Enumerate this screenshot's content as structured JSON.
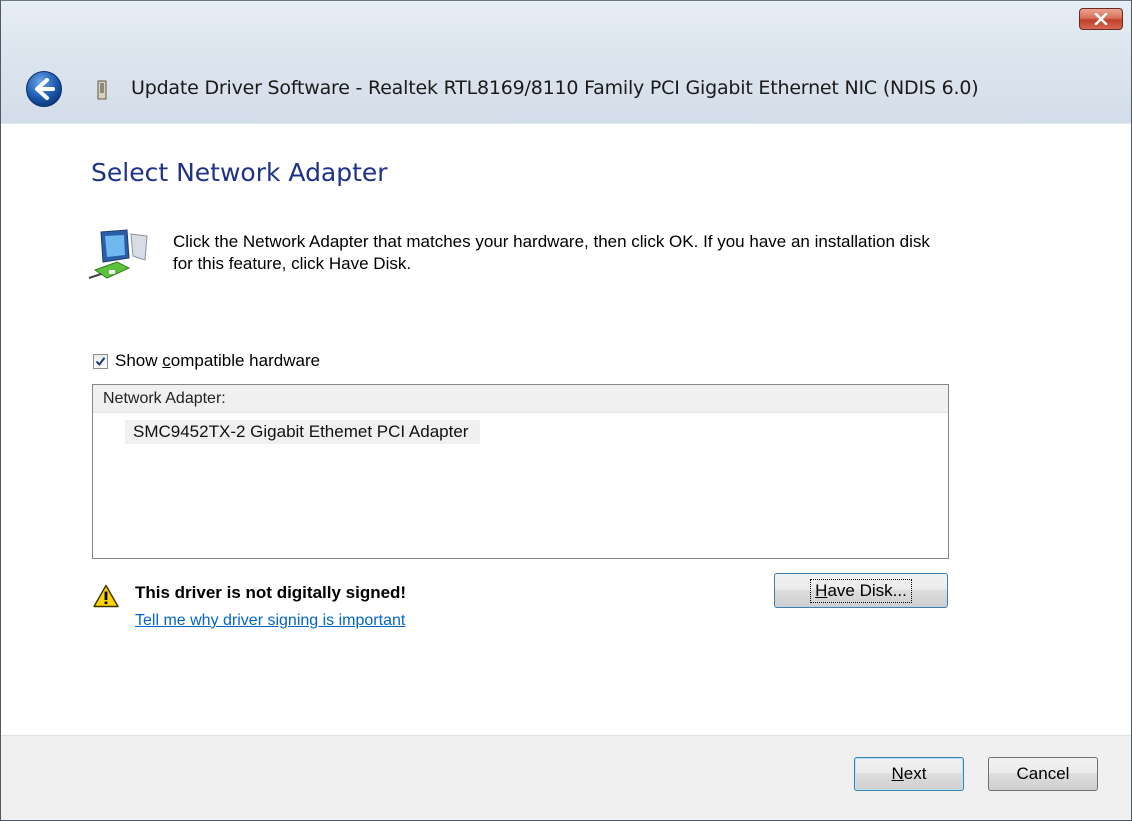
{
  "window": {
    "title": "Update Driver Software - Realtek RTL8169/8110 Family PCI Gigabit Ethernet NIC (NDIS 6.0)"
  },
  "page": {
    "heading": "Select Network Adapter",
    "instructions": "Click the Network Adapter that matches your hardware, then click OK. If you have an installation disk for this feature, click Have Disk."
  },
  "compatible": {
    "label_pre": "Show ",
    "label_u": "c",
    "label_post": "ompatible hardware",
    "checked": true
  },
  "list": {
    "header": "Network Adapter:",
    "items": [
      "SMC9452TX-2 Gigabit Ethemet PCI Adapter"
    ]
  },
  "warning": {
    "text": "This driver is not digitally signed!",
    "link": "Tell me why driver signing is important"
  },
  "buttons": {
    "have_disk_u": "H",
    "have_disk_rest": "ave Disk...",
    "next_u": "N",
    "next_rest": "ext",
    "cancel": "Cancel"
  },
  "colors": {
    "heading": "#1e3287",
    "link": "#0066cc",
    "close_button": "#c1402a"
  },
  "icons": [
    "back-arrow-icon",
    "device-icon",
    "close-icon",
    "network-adapter-icon",
    "checkmark-icon",
    "warning-icon"
  ]
}
